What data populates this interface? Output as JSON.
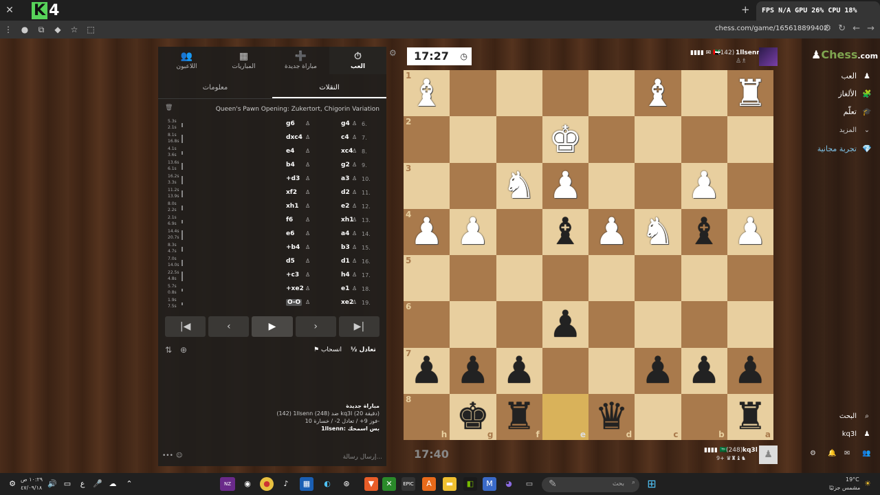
{
  "browser": {
    "close_label": "✕",
    "newtab_label": "+",
    "url": "chess.com/game/165618899402",
    "hud": "FPS N/A  GPU 26%  CPU 18%"
  },
  "panel": {
    "tabs": [
      {
        "label": "اللاعبون",
        "icon": "👥"
      },
      {
        "label": "المباريات",
        "icon": "▦"
      },
      {
        "label": "مباراة جديدة",
        "icon": "➕"
      },
      {
        "label": "العب",
        "icon": "⏱"
      }
    ],
    "subtabs": [
      "معلومات",
      "النقلات"
    ],
    "opening": "Queen's Pawn Opening: Zukertort, Chigorin Variation",
    "moves": [
      {
        "n": "6.",
        "w": "g4",
        "b": "g6",
        "tw": "5.3s",
        "tb": "2.1s",
        "h": 6
      },
      {
        "n": "7.",
        "w": "c4",
        "b": "dxc4",
        "tw": "8.1s",
        "tb": "16.8s",
        "h": 12
      },
      {
        "n": "8.",
        "w": "xc4",
        "b": "e4",
        "tw": "4.1s",
        "tb": "3.6s",
        "h": 5
      },
      {
        "n": "9.",
        "w": "g2",
        "b": "b4",
        "tw": "13.6s",
        "tb": "6.1s",
        "h": 10
      },
      {
        "n": "10.",
        "w": "a3",
        "b": "+d3",
        "tw": "16.2s",
        "tb": "3.3s",
        "h": 12
      },
      {
        "n": "11.",
        "w": "d2",
        "b": "xf2",
        "tw": "11.2s",
        "tb": "13.9s",
        "h": 10
      },
      {
        "n": "12.",
        "w": "e2",
        "b": "xh1",
        "tw": "8.0s",
        "tb": "2.2s",
        "h": 7
      },
      {
        "n": "13.",
        "w": "xh1",
        "b": "f6",
        "tw": "2.1s",
        "tb": "6.9s",
        "h": 5
      },
      {
        "n": "14.",
        "w": "a4",
        "b": "e6",
        "tw": "14.4s",
        "tb": "20.7s",
        "h": 14
      },
      {
        "n": "15.",
        "w": "b3",
        "b": "+b4",
        "tw": "8.3s",
        "tb": "4.7s",
        "h": 7
      },
      {
        "n": "16.",
        "w": "d1",
        "b": "d5",
        "tw": "7.0s",
        "tb": "14.0s",
        "h": 9
      },
      {
        "n": "17.",
        "w": "h4",
        "b": "+c3",
        "tw": "22.5s",
        "tb": "4.8s",
        "h": 14
      },
      {
        "n": "18.",
        "w": "e1",
        "b": "+xe2",
        "tw": "5.7s",
        "tb": "0.8s",
        "h": 4
      },
      {
        "n": "19.",
        "w": "xe2",
        "b": "O-O",
        "tw": "1.9s",
        "tb": "7.5s",
        "h": 4
      }
    ],
    "nav": [
      "|◀",
      "‹",
      "▶",
      "›",
      "▶|"
    ],
    "draw_label": "½ تعادل",
    "resign_label": "⚑ انسحاب",
    "chat": {
      "title": "مباراة جديدة",
      "line1": "(142) 1llsenn ضد (248) kq3l (20 دقيقة)",
      "line2": "فوز 9+ / تعادل 2- / خسارة 10-",
      "line3": "1llsenn: بس اسمحك"
    },
    "chat_placeholder": "إرسال رسالة..."
  },
  "clocks": {
    "top": "17:27",
    "bottom": "17:40"
  },
  "players": {
    "top": {
      "name": "1llsenn",
      "rating": "(142)",
      "bars": "▮▮▮▮ ✉ 🇦🇪"
    },
    "bottom": {
      "name": "kq3l",
      "rating": "(248)",
      "bars": "▮▮▮▮ 🇸🇦",
      "captures": "9+ ♛♜♝♞"
    }
  },
  "board": {
    "ranks": [
      "1",
      "2",
      "3",
      "4",
      "5",
      "6",
      "7",
      "8"
    ],
    "files": [
      "h",
      "g",
      "f",
      "e",
      "d",
      "c",
      "b",
      "a"
    ],
    "rows": [
      [
        "wB",
        "",
        "",
        "",
        "",
        "wB",
        "",
        "wR"
      ],
      [
        "",
        "",
        "",
        "wK",
        "",
        "",
        "",
        ""
      ],
      [
        "",
        "",
        "wN",
        "wP",
        "",
        "",
        "wP",
        ""
      ],
      [
        "wP",
        "wP",
        "",
        "bB",
        "wP",
        "wN",
        "bB",
        "wP"
      ],
      [
        "",
        "",
        "",
        "",
        "",
        "",
        "",
        ""
      ],
      [
        "",
        "",
        "",
        "bP",
        "",
        "",
        "",
        ""
      ],
      [
        "bP",
        "bP",
        "bP",
        "",
        "",
        "bP",
        "bP",
        "bP"
      ],
      [
        "",
        "bK",
        "bR",
        "",
        "bQ",
        "",
        "",
        "bR"
      ]
    ]
  },
  "sidebar": {
    "brand": "Chess",
    "brand_suffix": ".com",
    "items": [
      {
        "label": "العب",
        "icon": "♟"
      },
      {
        "label": "الألغاز",
        "icon": "🧩"
      },
      {
        "label": "تعلّم",
        "icon": "🎓"
      },
      {
        "label": "المزيد",
        "icon": "⌄"
      },
      {
        "label": "تجربة مجانية",
        "icon": "💎"
      }
    ],
    "search_label": "البحث",
    "user_label": "kq3l"
  },
  "taskbar": {
    "time": "١٠:٢٩ ص",
    "date": "٤٧/٠٩/١٨",
    "search_placeholder": "بحث",
    "weather": "19°C",
    "weather_desc": "مشمس جزئيًا"
  }
}
